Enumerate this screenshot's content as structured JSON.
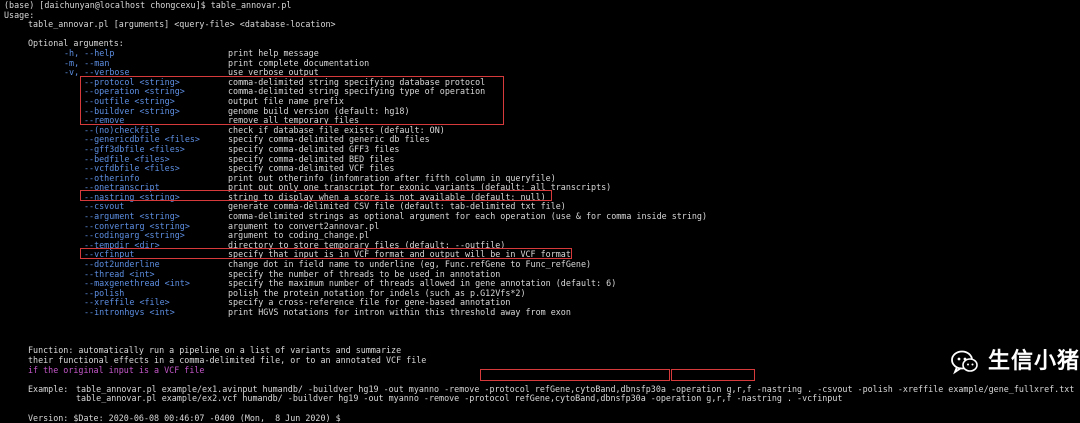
{
  "terminal": {
    "prompt": "(base) [daichunyan@localhost chongcexu]$ table_annovar.pl",
    "usage_label": "Usage:",
    "usage_line": "table_annovar.pl [arguments] <query-file> <database-location>",
    "optional_heading": "Optional arguments:",
    "options": [
      {
        "opt": "-h, --help",
        "desc": "print help message"
      },
      {
        "opt": "-m, --man",
        "desc": "print complete documentation"
      },
      {
        "opt": "-v, --verbose",
        "desc": "use verbose output"
      },
      {
        "opt": "--protocol <string>",
        "desc": "comma-delimited string specifying database protocol"
      },
      {
        "opt": "--operation <string>",
        "desc": "comma-delimited string specifying type of operation"
      },
      {
        "opt": "--outfile <string>",
        "desc": "output file name prefix"
      },
      {
        "opt": "--buildver <string>",
        "desc": "genome build version (default: hg18)"
      },
      {
        "opt": "--remove",
        "desc": "remove all temporary files"
      },
      {
        "opt": "--(no)checkfile",
        "desc": "check if database file exists (default: ON)"
      },
      {
        "opt": "--genericdbfile <files>",
        "desc": "specify comma-delimited generic db files"
      },
      {
        "opt": "--gff3dbfile <files>",
        "desc": "specify comma-delimited GFF3 files"
      },
      {
        "opt": "--bedfile <files>",
        "desc": "specify comma-delimited BED files"
      },
      {
        "opt": "--vcfdbfile <files>",
        "desc": "specify comma-delimited VCF files"
      },
      {
        "opt": "--otherinfo",
        "desc": "print out otherinfo (infomration after fifth column in queryfile)"
      },
      {
        "opt": "--onetranscript",
        "desc": "print out only one transcript for exonic variants (default: all transcripts)"
      },
      {
        "opt": "--nastring <string>",
        "desc": "string to display when a score is not available (default: null)"
      },
      {
        "opt": "--csvout",
        "desc": "generate comma-delimited CSV file (default: tab-delimited txt file)"
      },
      {
        "opt": "--argument <string>",
        "desc": "comma-delimited strings as optional argument for each operation (use & for comma inside string)"
      },
      {
        "opt": "--convertarg <string>",
        "desc": "argument to convert2annovar.pl"
      },
      {
        "opt": "--codingarg <string>",
        "desc": "argument to coding_change.pl"
      },
      {
        "opt": "--tempdir <dir>",
        "desc": "directory to store temporary files (default: --outfile)"
      },
      {
        "opt": "--vcfinput",
        "desc": "specify that input is in VCF format and output will be in VCF format"
      },
      {
        "opt": "--dot2underline",
        "desc": "change dot in field name to underline (eg, Func.refGene to Func_refGene)"
      },
      {
        "opt": "--thread <int>",
        "desc": "specify the number of threads to be used in annotation"
      },
      {
        "opt": "--maxgenethread <int>",
        "desc": "specify the maximum number of threads allowed in gene annotation (default: 6)"
      },
      {
        "opt": "--polish",
        "desc": "polish the protein notation for indels (such as p.G12Vfs*2)"
      },
      {
        "opt": "--xreffile <file>",
        "desc": "specify a cross-reference file for gene-based annotation"
      },
      {
        "opt": "--intronhgvs <int>",
        "desc": "print HGVS notations for intron within this threshold away from exon"
      }
    ],
    "function_lines": [
      "Function: automatically run a pipeline on a list of variants and summarize",
      "their functional effects in a comma-delimited file, or to an annotated VCF file",
      "if the original input is a VCF file"
    ],
    "example_label": "Example:",
    "example_lines": [
      "table_annovar.pl example/ex1.avinput humandb/ -buildver hg19 -out myanno -remove -protocol refGene,cytoBand,dbnsfp30a -operation g,r,f -nastring . -csvout -polish -xreffile example/gene_fullxref.txt",
      "table_annovar.pl example/ex2.vcf humandb/ -buildver hg19 -out myanno -remove -protocol refGene,cytoBand,dbnsfp30a -operation g,r,f -nastring . -vcfinput"
    ],
    "version_line": "Version: $Date: 2020-06-08 00:46:07 -0400 (Mon,  8 Jun 2020) $"
  },
  "watermark": {
    "text": "生信小猪",
    "icon": "wechat-icon"
  },
  "colors": {
    "background": "#000000",
    "text": "#d8d8d8",
    "option_blue": "#5d8fe3",
    "highlight_red": "#d63a3a"
  }
}
